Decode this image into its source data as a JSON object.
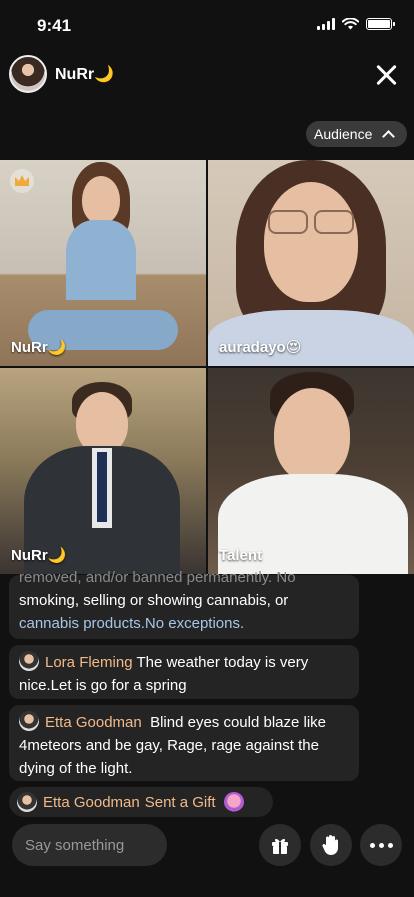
{
  "status_bar": {
    "time": "9:41"
  },
  "header": {
    "host_name": "NuRr🌙",
    "audience_label": "Audience"
  },
  "grid": {
    "tiles": [
      {
        "label": "NuRr🌙",
        "crown": true
      },
      {
        "label": "auradayo😍"
      },
      {
        "label": "NuRr🌙"
      },
      {
        "label": "Talent"
      }
    ]
  },
  "chat": {
    "notice_partial": "removed, and/or banned permanently. No",
    "notice_line2": "smoking, selling or showing cannabis, or",
    "notice_line3": "cannabis products.No exceptions.",
    "messages": [
      {
        "user": "Lora Fleming",
        "text": "The weather today is very nice.Let is go for a spring"
      },
      {
        "user": "Etta Goodman",
        "text": "Blind eyes could blaze like 4meteors and be gay, Rage, rage against the dying of the light."
      }
    ],
    "gift": {
      "user": "Etta Goodman",
      "text": "Sent a Gift"
    }
  },
  "bottom_bar": {
    "say_placeholder": "Say something",
    "icons": [
      "gift-icon",
      "hand-icon",
      "more-icon"
    ]
  },
  "colors": {
    "background": "#111111",
    "username": "#f2b98a",
    "bubble": "#242424"
  }
}
